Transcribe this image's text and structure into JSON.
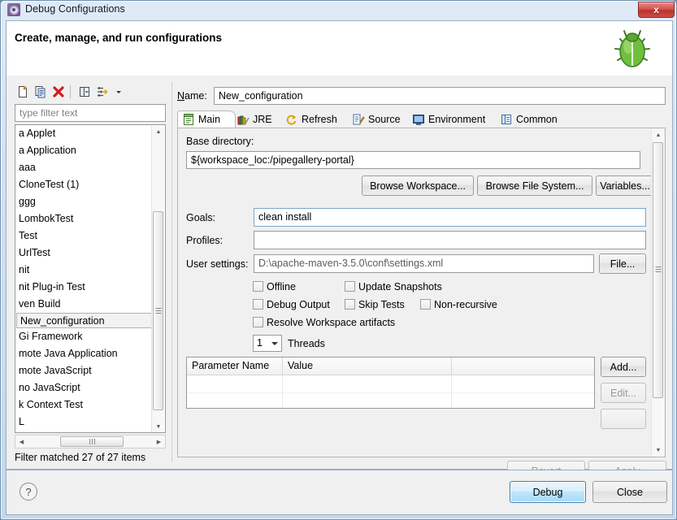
{
  "window": {
    "title": "Debug Configurations",
    "title_icon": "gear-icon",
    "close_label": "x",
    "header_title": "Create, manage, and run configurations",
    "header_icon": "green-bug-icon"
  },
  "left_panel": {
    "toolbar": [
      {
        "name": "new-configuration-icon",
        "tooltip": "New launch configuration"
      },
      {
        "name": "duplicate-configuration-icon",
        "tooltip": "Duplicate"
      },
      {
        "name": "delete-configuration-icon",
        "tooltip": "Delete"
      },
      {
        "name": "collapse-all-icon",
        "tooltip": "Collapse All"
      },
      {
        "name": "filter-icon",
        "tooltip": "Filter launch configurations"
      },
      {
        "name": "chevron-down-icon",
        "tooltip": "Menu"
      }
    ],
    "filter": {
      "placeholder": "type filter text",
      "value": ""
    },
    "tree_items": [
      {
        "label": "a Applet",
        "selected": false
      },
      {
        "label": "a Application",
        "selected": false
      },
      {
        "label": "aaa",
        "selected": false
      },
      {
        "label": "CloneTest (1)",
        "selected": false
      },
      {
        "label": "ggg",
        "selected": false
      },
      {
        "label": "LombokTest",
        "selected": false
      },
      {
        "label": "Test",
        "selected": false
      },
      {
        "label": "UrlTest",
        "selected": false
      },
      {
        "label": "nit",
        "selected": false
      },
      {
        "label": "nit Plug-in Test",
        "selected": false
      },
      {
        "label": "ven Build",
        "selected": false
      },
      {
        "label": "New_configuration",
        "selected": true
      },
      {
        "label": "Gi Framework",
        "selected": false
      },
      {
        "label": "mote Java Application",
        "selected": false
      },
      {
        "label": "mote JavaScript",
        "selected": false
      },
      {
        "label": "no JavaScript",
        "selected": false
      },
      {
        "label": "k Context Test",
        "selected": false
      },
      {
        "label": "L",
        "selected": false
      }
    ],
    "status": "Filter matched 27 of 27 items"
  },
  "right_panel": {
    "name_label": "Name:",
    "name_value": "New_configuration",
    "tabs": [
      {
        "label": "Main",
        "icon": "main-tab-icon",
        "active": true
      },
      {
        "label": "JRE",
        "icon": "jre-books-icon",
        "active": false
      },
      {
        "label": "Refresh",
        "icon": "refresh-arrows-icon",
        "active": false
      },
      {
        "label": "Source",
        "icon": "source-pencil-icon",
        "active": false
      },
      {
        "label": "Environment",
        "icon": "environment-icon",
        "active": false
      },
      {
        "label": "Common",
        "icon": "common-icon",
        "active": false
      }
    ],
    "main_tab": {
      "base_directory_label": "Base directory:",
      "base_directory_value": "${workspace_loc:/pipegallery-portal}",
      "browse_workspace_label": "Browse Workspace...",
      "browse_filesystem_label": "Browse File System...",
      "variables_label": "Variables...",
      "goals_label": "Goals:",
      "goals_value": "clean install",
      "profiles_label": "Profiles:",
      "profiles_value": "",
      "user_settings_label": "User settings:",
      "user_settings_value": "D:\\apache-maven-3.5.0\\conf\\settings.xml",
      "file_button_label": "File...",
      "checkboxes": [
        {
          "label": "Offline",
          "checked": false
        },
        {
          "label": "Update Snapshots",
          "checked": false
        },
        {
          "label": "Debug Output",
          "checked": false
        },
        {
          "label": "Skip Tests",
          "checked": false
        },
        {
          "label": "Non-recursive",
          "checked": false
        },
        {
          "label": "Resolve Workspace artifacts",
          "checked": false
        }
      ],
      "threads_value": "1",
      "threads_label": "Threads",
      "table": {
        "columns": [
          "Parameter Name",
          "Value"
        ],
        "rows": []
      },
      "add_label": "Add...",
      "edit_label": "Edit..."
    }
  },
  "footer": {
    "revert_label": "Revert",
    "apply_label": "Apply",
    "help_icon": "question-mark-icon",
    "debug_label": "Debug",
    "close_label": "Close"
  }
}
